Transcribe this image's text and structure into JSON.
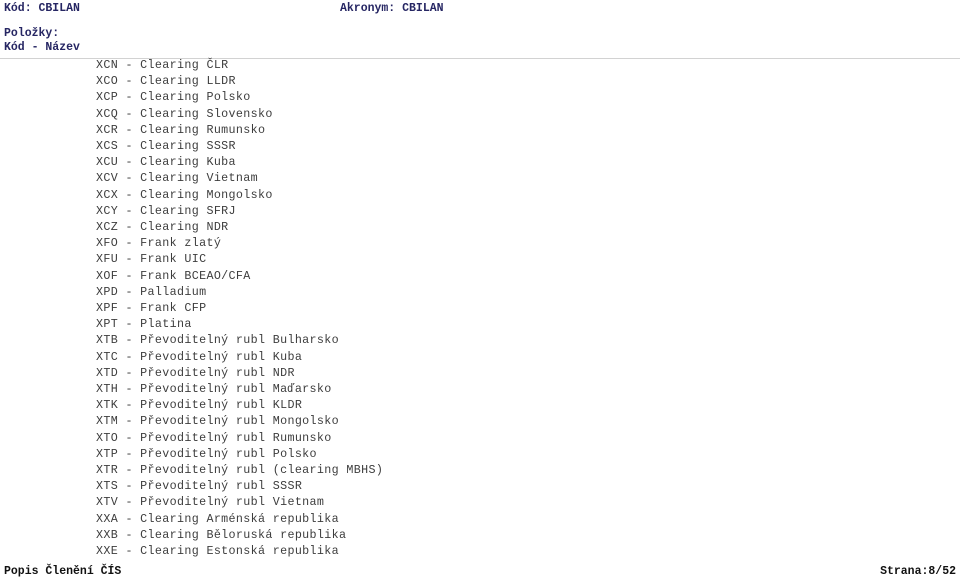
{
  "header": {
    "code_label": "Kód: CBILAN",
    "acronym_label": "Akronym: CBILAN",
    "items_label": "Položky:",
    "columns_label": "Kód - Název"
  },
  "items": [
    "XCN - Clearing ČLR",
    "XCO - Clearing LLDR",
    "XCP - Clearing Polsko",
    "XCQ - Clearing Slovensko",
    "XCR - Clearing Rumunsko",
    "XCS - Clearing SSSR",
    "XCU - Clearing Kuba",
    "XCV - Clearing Vietnam",
    "XCX - Clearing Mongolsko",
    "XCY - Clearing SFRJ",
    "XCZ - Clearing NDR",
    "XFO - Frank zlatý",
    "XFU - Frank UIC",
    "XOF - Frank BCEAO/CFA",
    "XPD - Palladium",
    "XPF - Frank CFP",
    "XPT - Platina",
    "XTB - Převoditelný rubl Bulharsko",
    "XTC - Převoditelný rubl Kuba",
    "XTD - Převoditelný rubl NDR",
    "XTH - Převoditelný rubl Maďarsko",
    "XTK - Převoditelný rubl KLDR",
    "XTM - Převoditelný rubl Mongolsko",
    "XTO - Převoditelný rubl Rumunsko",
    "XTP - Převoditelný rubl Polsko",
    "XTR - Převoditelný rubl (clearing MBHS)",
    "XTS - Převoditelný rubl SSSR",
    "XTV - Převoditelný rubl Vietnam",
    "XXA - Clearing Arménská republika",
    "XXB - Clearing Běloruská republika",
    "XXE - Clearing Estonská republika"
  ],
  "footer": {
    "title": "Popis Členění ČÍS",
    "page": "Strana:8/52"
  },
  "colors": {
    "header_text": "#262663",
    "body_text": "#3d3d3d",
    "footer_text": "#111111",
    "rule": "#d2d2d2",
    "background": "#ffffff"
  }
}
